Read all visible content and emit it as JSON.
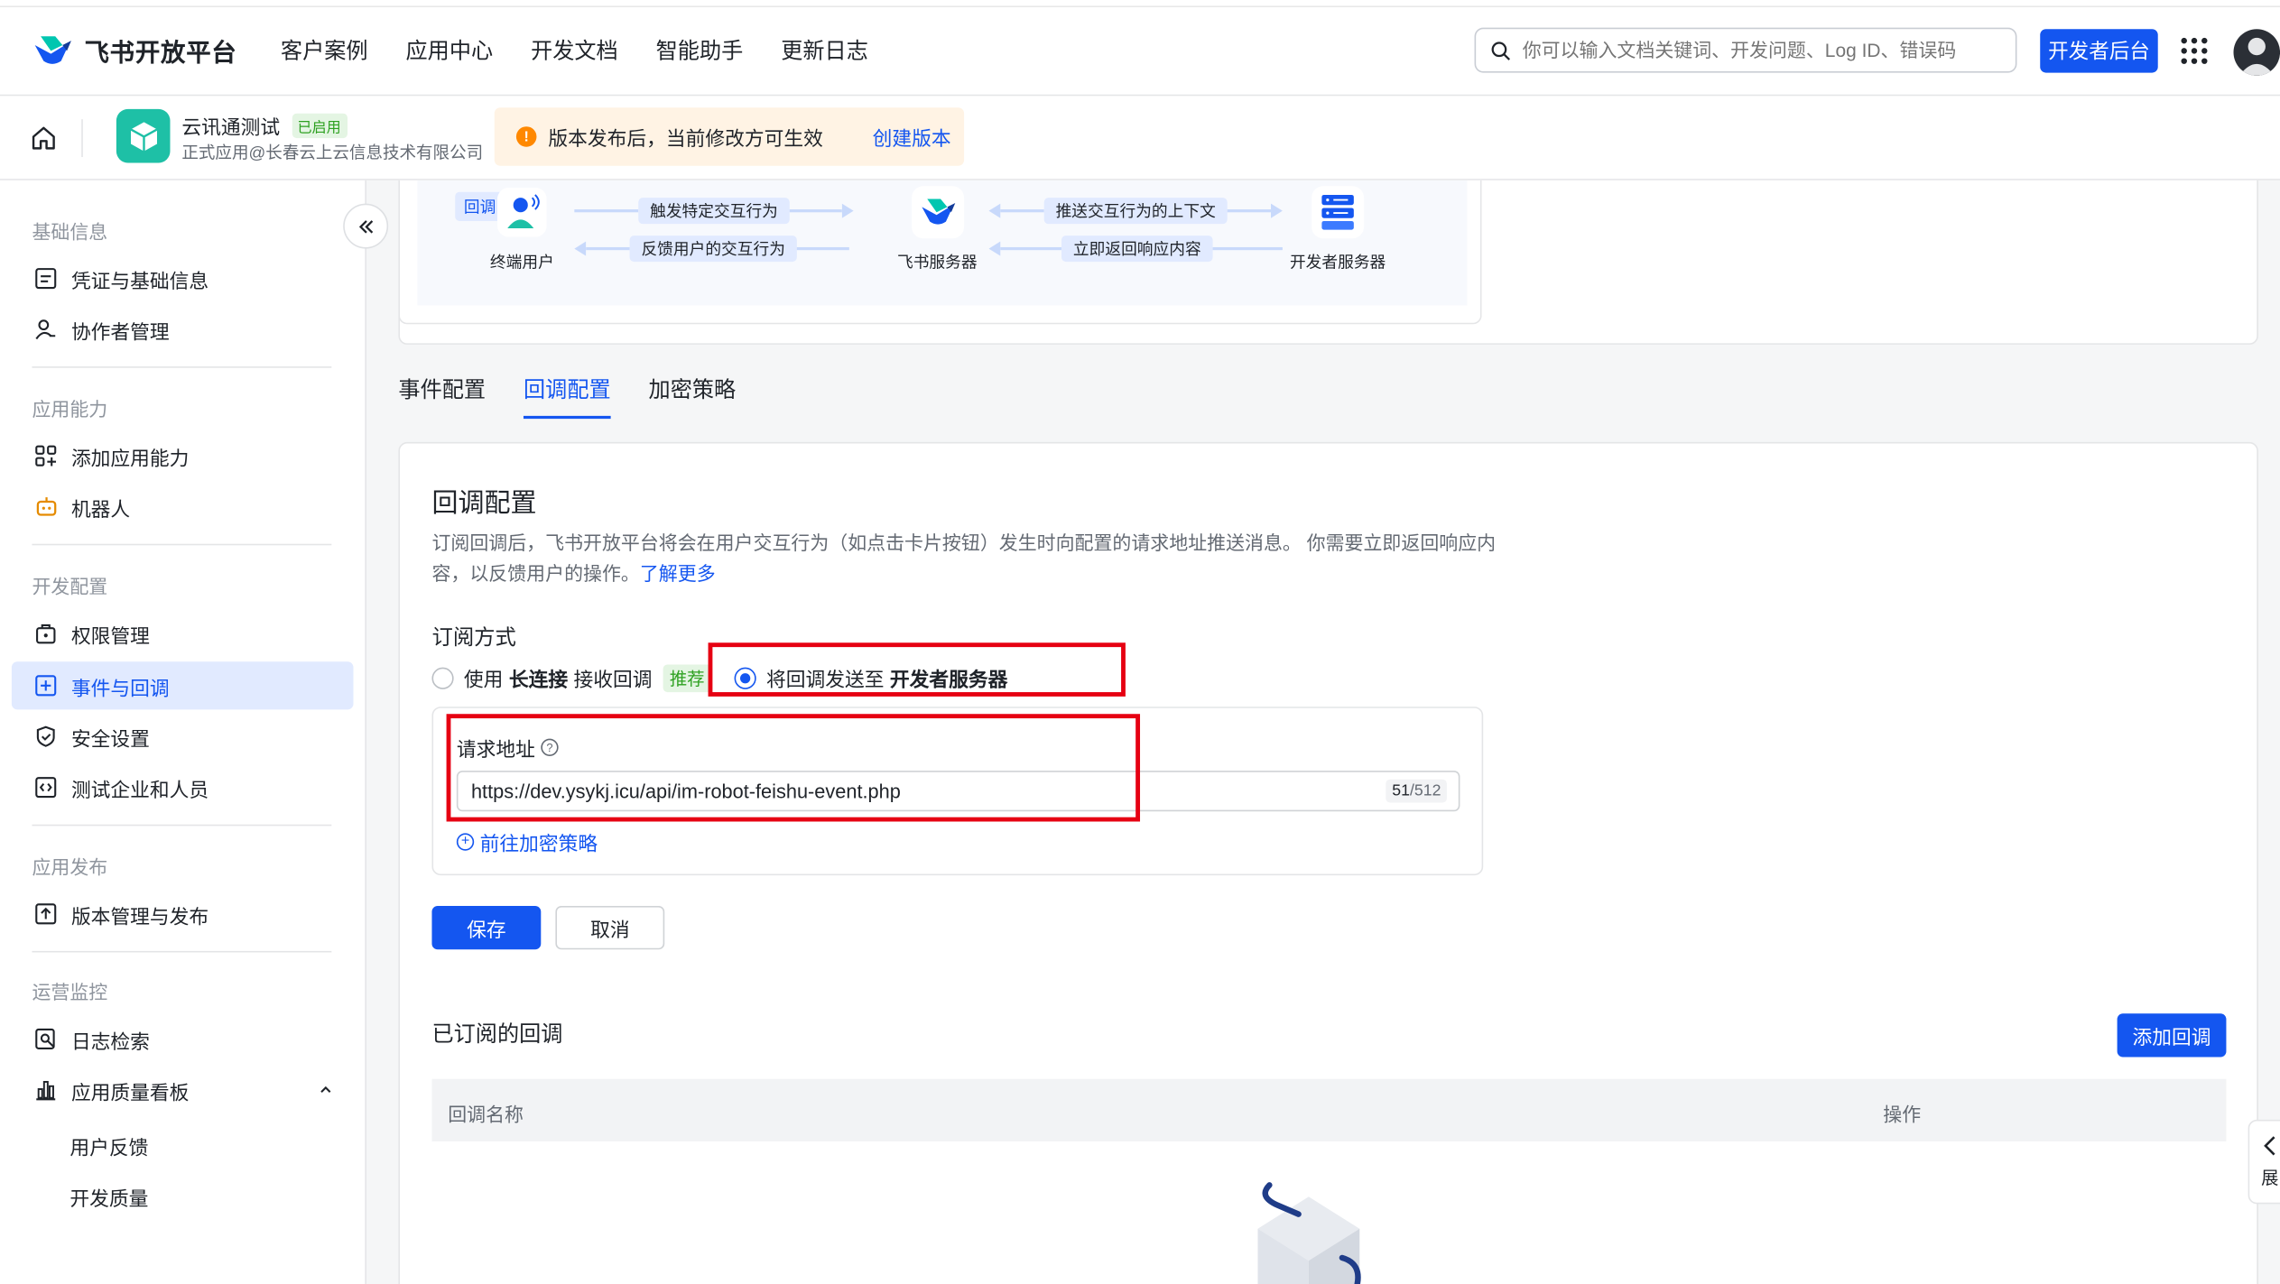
{
  "brand": {
    "name": "飞书开放平台"
  },
  "nav": {
    "items": [
      "客户案例",
      "应用中心",
      "开发文档",
      "智能助手",
      "更新日志"
    ]
  },
  "search": {
    "placeholder": "你可以输入文档关键词、开发问题、Log ID、错误码"
  },
  "header": {
    "dev_console": "开发者后台"
  },
  "app": {
    "name": "云讯通测试",
    "status": "已启用",
    "subtitle": "正式应用@长春云上云信息技术有限公司"
  },
  "notice": {
    "text": "版本发布后，当前修改方可生效",
    "action": "创建版本"
  },
  "sidebar": {
    "sections": [
      {
        "title": "基础信息",
        "items": [
          "凭证与基础信息",
          "协作者管理"
        ]
      },
      {
        "title": "应用能力",
        "items": [
          "添加应用能力",
          "机器人"
        ]
      },
      {
        "title": "开发配置",
        "items": [
          "权限管理",
          "事件与回调",
          "安全设置",
          "测试企业和人员"
        ]
      },
      {
        "title": "应用发布",
        "items": [
          "版本管理与发布"
        ]
      },
      {
        "title": "运营监控",
        "items": [
          "日志检索",
          "应用质量看板"
        ]
      }
    ],
    "sub_items": [
      "用户反馈",
      "开发质量"
    ],
    "active": "事件与回调"
  },
  "diagram": {
    "tag": "回调",
    "nodes": [
      "终端用户",
      "飞书服务器",
      "开发者服务器"
    ],
    "flows": [
      "触发特定交互行为",
      "反馈用户的交互行为",
      "推送交互行为的上下文",
      "立即返回响应内容"
    ]
  },
  "tabs": [
    "事件配置",
    "回调配置",
    "加密策略"
  ],
  "active_tab": "回调配置",
  "callback": {
    "title": "回调配置",
    "desc": "订阅回调后，飞书开放平台将会在用户交互行为（如点击卡片按钮）发生时向配置的请求地址推送消息。 你需要立即返回响应内容，以反馈用户的操作。",
    "learn_more": "了解更多",
    "mode_label": "订阅方式",
    "option1": {
      "pre": "使用",
      "bold": "长连接",
      "post": "接收回调",
      "tag": "推荐"
    },
    "option2": {
      "pre": "将回调发送至",
      "bold": "开发者服务器"
    },
    "url_label": "请求地址",
    "url_value": "https://dev.ysykj.icu/api/im-robot-feishu-event.php",
    "url_count": "51",
    "url_max": "/512",
    "encrypt_link": "前往加密策略",
    "save": "保存",
    "cancel": "取消"
  },
  "subscribed": {
    "title": "已订阅的回调",
    "add": "添加回调",
    "columns": [
      "回调名称",
      "操作"
    ]
  },
  "float": {
    "label": "展"
  },
  "colors": {
    "primary": "#1456f0",
    "highlight_box": "#e60012",
    "app_icon": "#1ec0a6"
  }
}
